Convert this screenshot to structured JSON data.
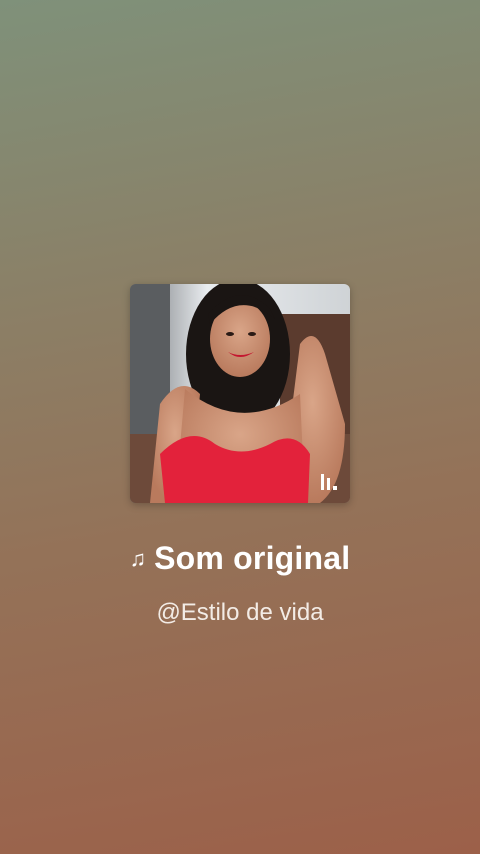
{
  "audio": {
    "title": "Som original",
    "author": "@Estilo de vida",
    "note_icon": "♫"
  },
  "cover": {
    "icon": "brand-bars-icon"
  }
}
